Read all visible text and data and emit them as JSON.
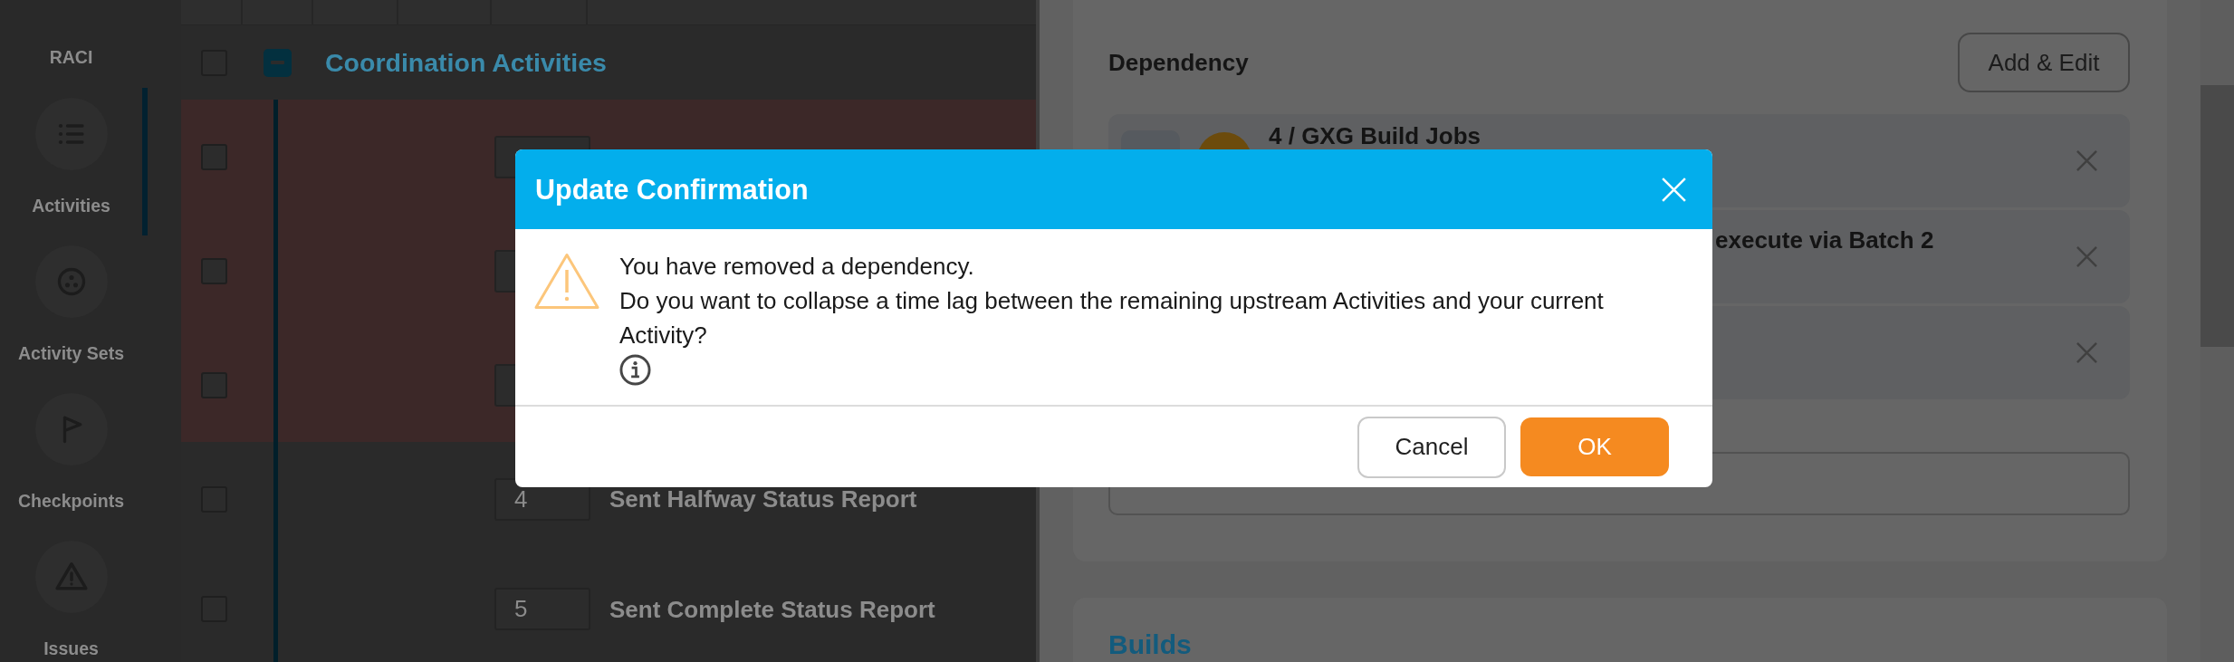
{
  "sidebar": {
    "items": [
      {
        "label": "RACI",
        "selected": false
      },
      {
        "label": "Activities",
        "selected": true
      },
      {
        "label": "Activity Sets",
        "selected": false
      },
      {
        "label": "Checkpoints",
        "selected": false
      },
      {
        "label": "Issues",
        "selected": false
      }
    ]
  },
  "activity_group": {
    "title": "Coordination Activities",
    "checked": false,
    "expanded": true,
    "rows": [
      {
        "checked": false,
        "highlighted": true
      },
      {
        "checked": false,
        "highlighted": true
      },
      {
        "checked": false,
        "highlighted": true
      },
      {
        "number": "4",
        "title": "Sent Halfway Status Report",
        "checked": false,
        "highlighted": false
      },
      {
        "number": "5",
        "title": "Sent Complete Status Report",
        "checked": false,
        "highlighted": false
      }
    ]
  },
  "detail_panel": {
    "dependency": {
      "title": "Dependency",
      "button": "Add & Edit",
      "items": [
        {
          "kind": "full",
          "title": "4 / GXG Build Jobs"
        },
        {
          "kind": "clipped",
          "title": "execute via Batch 2"
        },
        {
          "kind": "empty"
        }
      ]
    },
    "builds": {
      "title": "Builds"
    }
  },
  "dialog": {
    "title": "Update Confirmation",
    "message": [
      "You have removed a dependency.",
      "Do you want to collapse a time lag between the remaining upstream Activities and your current Activity?"
    ],
    "buttons": [
      {
        "label": "Cancel",
        "kind": "secondary"
      },
      {
        "label": "OK",
        "kind": "primary"
      }
    ]
  }
}
